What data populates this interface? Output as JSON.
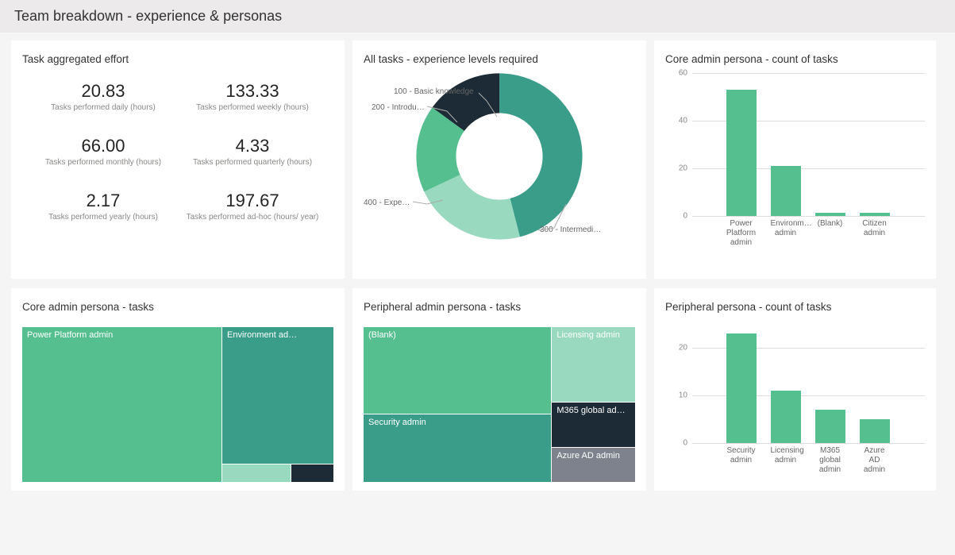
{
  "header": {
    "title": "Team breakdown - experience & personas"
  },
  "metrics_card": {
    "title": "Task aggregated effort",
    "items": [
      {
        "value": "20.83",
        "label": "Tasks performed daily (hours)"
      },
      {
        "value": "133.33",
        "label": "Tasks performed weekly (hours)"
      },
      {
        "value": "66.00",
        "label": "Tasks performed monthly (hours)"
      },
      {
        "value": "4.33",
        "label": "Tasks performed quarterly (hours)"
      },
      {
        "value": "2.17",
        "label": "Tasks performed yearly (hours)"
      },
      {
        "value": "197.67",
        "label": "Tasks performed ad-hoc (hours/ year)"
      }
    ]
  },
  "donut_card": {
    "title": "All tasks - experience levels required"
  },
  "bar1_card": {
    "title": "Core admin persona - count of tasks"
  },
  "tree1_card": {
    "title": "Core admin persona - tasks"
  },
  "tree2_card": {
    "title": "Peripheral admin persona - tasks"
  },
  "bar2_card": {
    "title": "Peripheral persona - count of tasks"
  },
  "chart_data": [
    {
      "id": "donut_experience",
      "type": "pie",
      "title": "All tasks - experience levels required",
      "series": [
        {
          "name": "300 - Intermedi…",
          "value": 46,
          "color": "#399d8a"
        },
        {
          "name": "400 - Expe…",
          "value": 22,
          "color": "#99d9c0"
        },
        {
          "name": "200 - Introdu…",
          "value": 17,
          "color": "#55bf8f"
        },
        {
          "name": "100 - Basic knowledge",
          "value": 15,
          "color": "#1c2b36"
        }
      ],
      "donut_hole": 0.55
    },
    {
      "id": "bar_core_count",
      "type": "bar",
      "title": "Core admin persona - count of tasks",
      "ylabel": "",
      "xlabel": "",
      "ylim": [
        0,
        60
      ],
      "yticks": [
        0,
        20,
        40,
        60
      ],
      "categories": [
        "Power Platform admin",
        "Environm… admin",
        "(Blank)",
        "Citizen admin"
      ],
      "values": [
        53,
        21,
        1,
        1
      ],
      "color": "#55bf8f"
    },
    {
      "id": "tree_core_tasks",
      "type": "treemap",
      "title": "Core admin persona - tasks",
      "series": [
        {
          "name": "Power Platform admin",
          "value": 53,
          "color": "#55bf8f"
        },
        {
          "name": "Environment ad…",
          "value": 21,
          "color": "#399d8a"
        },
        {
          "name": "",
          "value": 3,
          "color": "#99d9c0"
        },
        {
          "name": "",
          "value": 2,
          "color": "#1c2b36"
        }
      ]
    },
    {
      "id": "tree_peripheral_tasks",
      "type": "treemap",
      "title": "Peripheral admin persona - tasks",
      "series": [
        {
          "name": "(Blank)",
          "value": 30,
          "color": "#55bf8f"
        },
        {
          "name": "Security admin",
          "value": 23,
          "color": "#399d8a"
        },
        {
          "name": "Licensing admin",
          "value": 11,
          "color": "#99d9c0"
        },
        {
          "name": "M365 global ad…",
          "value": 7,
          "color": "#1c2b36"
        },
        {
          "name": "Azure AD admin",
          "value": 5,
          "color": "#7d828c"
        }
      ]
    },
    {
      "id": "bar_peripheral_count",
      "type": "bar",
      "title": "Peripheral persona - count of tasks",
      "ylabel": "",
      "xlabel": "",
      "ylim": [
        0,
        25
      ],
      "yticks": [
        0,
        10,
        20
      ],
      "categories": [
        "Security admin",
        "Licensing admin",
        "M365 global admin",
        "Azure AD admin"
      ],
      "values": [
        23,
        11,
        7,
        5
      ],
      "color": "#55bf8f"
    }
  ]
}
